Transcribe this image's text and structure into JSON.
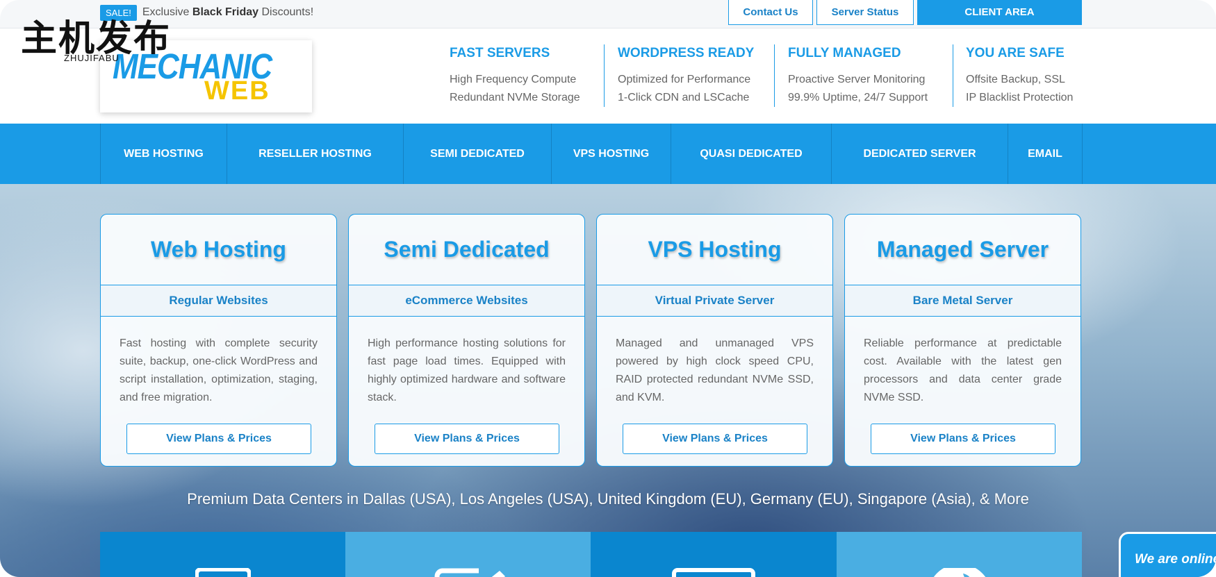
{
  "topbar": {
    "sale_badge": "SALE!",
    "sale_prefix": "Exclusive ",
    "sale_bold": "Black Friday",
    "sale_suffix": " Discounts!",
    "contact_label": "Contact Us",
    "status_label": "Server Status",
    "client_label": "CLIENT AREA"
  },
  "watermark": {
    "cn": "主机发布",
    "en": "ZHUJIFABU"
  },
  "logo": {
    "line1": "MECHANIC",
    "line2": "WEB"
  },
  "features": [
    {
      "title": "FAST SERVERS",
      "line1": "High Frequency Compute",
      "line2": "Redundant NVMe Storage"
    },
    {
      "title": "WORDPRESS READY",
      "line1": "Optimized for Performance",
      "line2": "1-Click CDN and LSCache"
    },
    {
      "title": "FULLY MANAGED",
      "line1": "Proactive Server Monitoring",
      "line2": "99.9% Uptime, 24/7 Support"
    },
    {
      "title": "YOU ARE SAFE",
      "line1": "Offsite Backup, SSL",
      "line2": "IP Blacklist Protection"
    }
  ],
  "nav": {
    "items": [
      "WEB HOSTING",
      "RESELLER HOSTING",
      "SEMI DEDICATED",
      "VPS HOSTING",
      "QUASI DEDICATED",
      "DEDICATED SERVER",
      "EMAIL"
    ]
  },
  "cards": [
    {
      "title": "Web Hosting",
      "subtitle": "Regular Websites",
      "desc": "Fast hosting with complete security suite, backup, one-click WordPress and script installation, optimization, staging, and free migration.",
      "button": "View Plans & Prices"
    },
    {
      "title": "Semi Dedicated",
      "subtitle": "eCommerce Websites",
      "desc": "High performance hosting solutions for fast page load times. Equipped with highly optimized hardware and software stack.",
      "button": "View Plans & Prices"
    },
    {
      "title": "VPS Hosting",
      "subtitle": "Virtual Private Server",
      "desc": "Managed and unmanaged VPS powered by high clock speed CPU, RAID protected redundant NVMe SSD, and KVM.",
      "button": "View Plans & Prices"
    },
    {
      "title": "Managed Server",
      "subtitle": "Bare Metal Server",
      "desc": "Reliable performance at predictable cost. Available with the latest gen processors and data center grade NVMe SSD.",
      "button": "View Plans & Prices"
    }
  ],
  "datacenters": "Premium Data Centers in Dallas (USA), Los Angeles (USA), United Kingdom (EU), Germany (EU), Singapore (Asia), & More",
  "tiles": [
    {
      "icon": "laptop-icon",
      "color": "#0a86cf"
    },
    {
      "icon": "edit-icon",
      "color": "#4aaee2"
    },
    {
      "icon": "monitor-icon",
      "color": "#0a86cf"
    },
    {
      "icon": "globe-icon",
      "color": "#4aaee2"
    }
  ],
  "chat": {
    "label": "We are online"
  },
  "colors": {
    "brand": "#1a9be6",
    "logo_yellow": "#f5c400"
  }
}
